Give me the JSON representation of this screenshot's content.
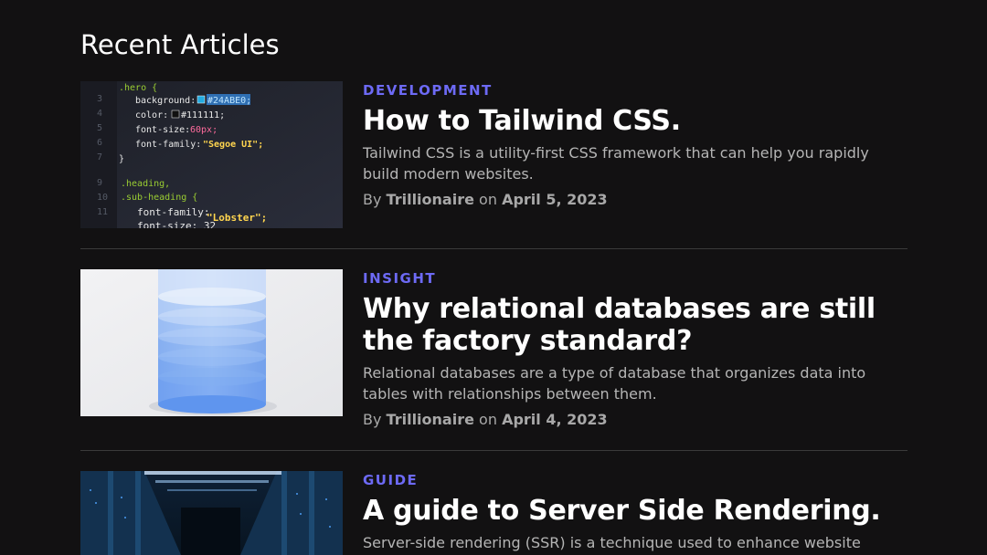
{
  "section": {
    "title": "Recent Articles"
  },
  "articles": [
    {
      "category": "DEVELOPMENT",
      "title": "How to Tailwind CSS.",
      "excerpt": "Tailwind CSS is a utility-first CSS framework that can help you rapidly build modern websites.",
      "by_label": "By",
      "author": "Trillionaire",
      "on_label": "on",
      "date": "April 5, 2023",
      "image": "code-editor-screenshot",
      "code": {
        "l1": ".hero {",
        "l2a": "background:",
        "l2b": "#24ABE0;",
        "l3a": "color:",
        "l3b": "#111111;",
        "l4a": "font-size:",
        "l4b": "60px;",
        "l5a": "font-family:",
        "l5b": "\"Segoe UI\";",
        "l6": "}",
        "l7": ".heading,",
        "l8": ".sub-heading {",
        "l9a": "font-family:",
        "l9b": "\"Lobster\";",
        "l10": "font-size: 32"
      }
    },
    {
      "category": "INSIGHT",
      "title": "Why relational databases are still the factory standard?",
      "excerpt": "Relational databases are a type of database that organizes data into tables with relationships between them.",
      "by_label": "By",
      "author": "Trillionaire",
      "on_label": "on",
      "date": "April 4, 2023",
      "image": "database-cylinder"
    },
    {
      "category": "GUIDE",
      "title": "A guide to Server Side Rendering.",
      "excerpt": "Server-side rendering (SSR) is a technique used to enhance website",
      "image": "server-room"
    }
  ],
  "colors": {
    "background": "#121112",
    "accent": "#6d6af5",
    "divider": "#3a3a3a",
    "text_muted": "#b5b5b5"
  }
}
